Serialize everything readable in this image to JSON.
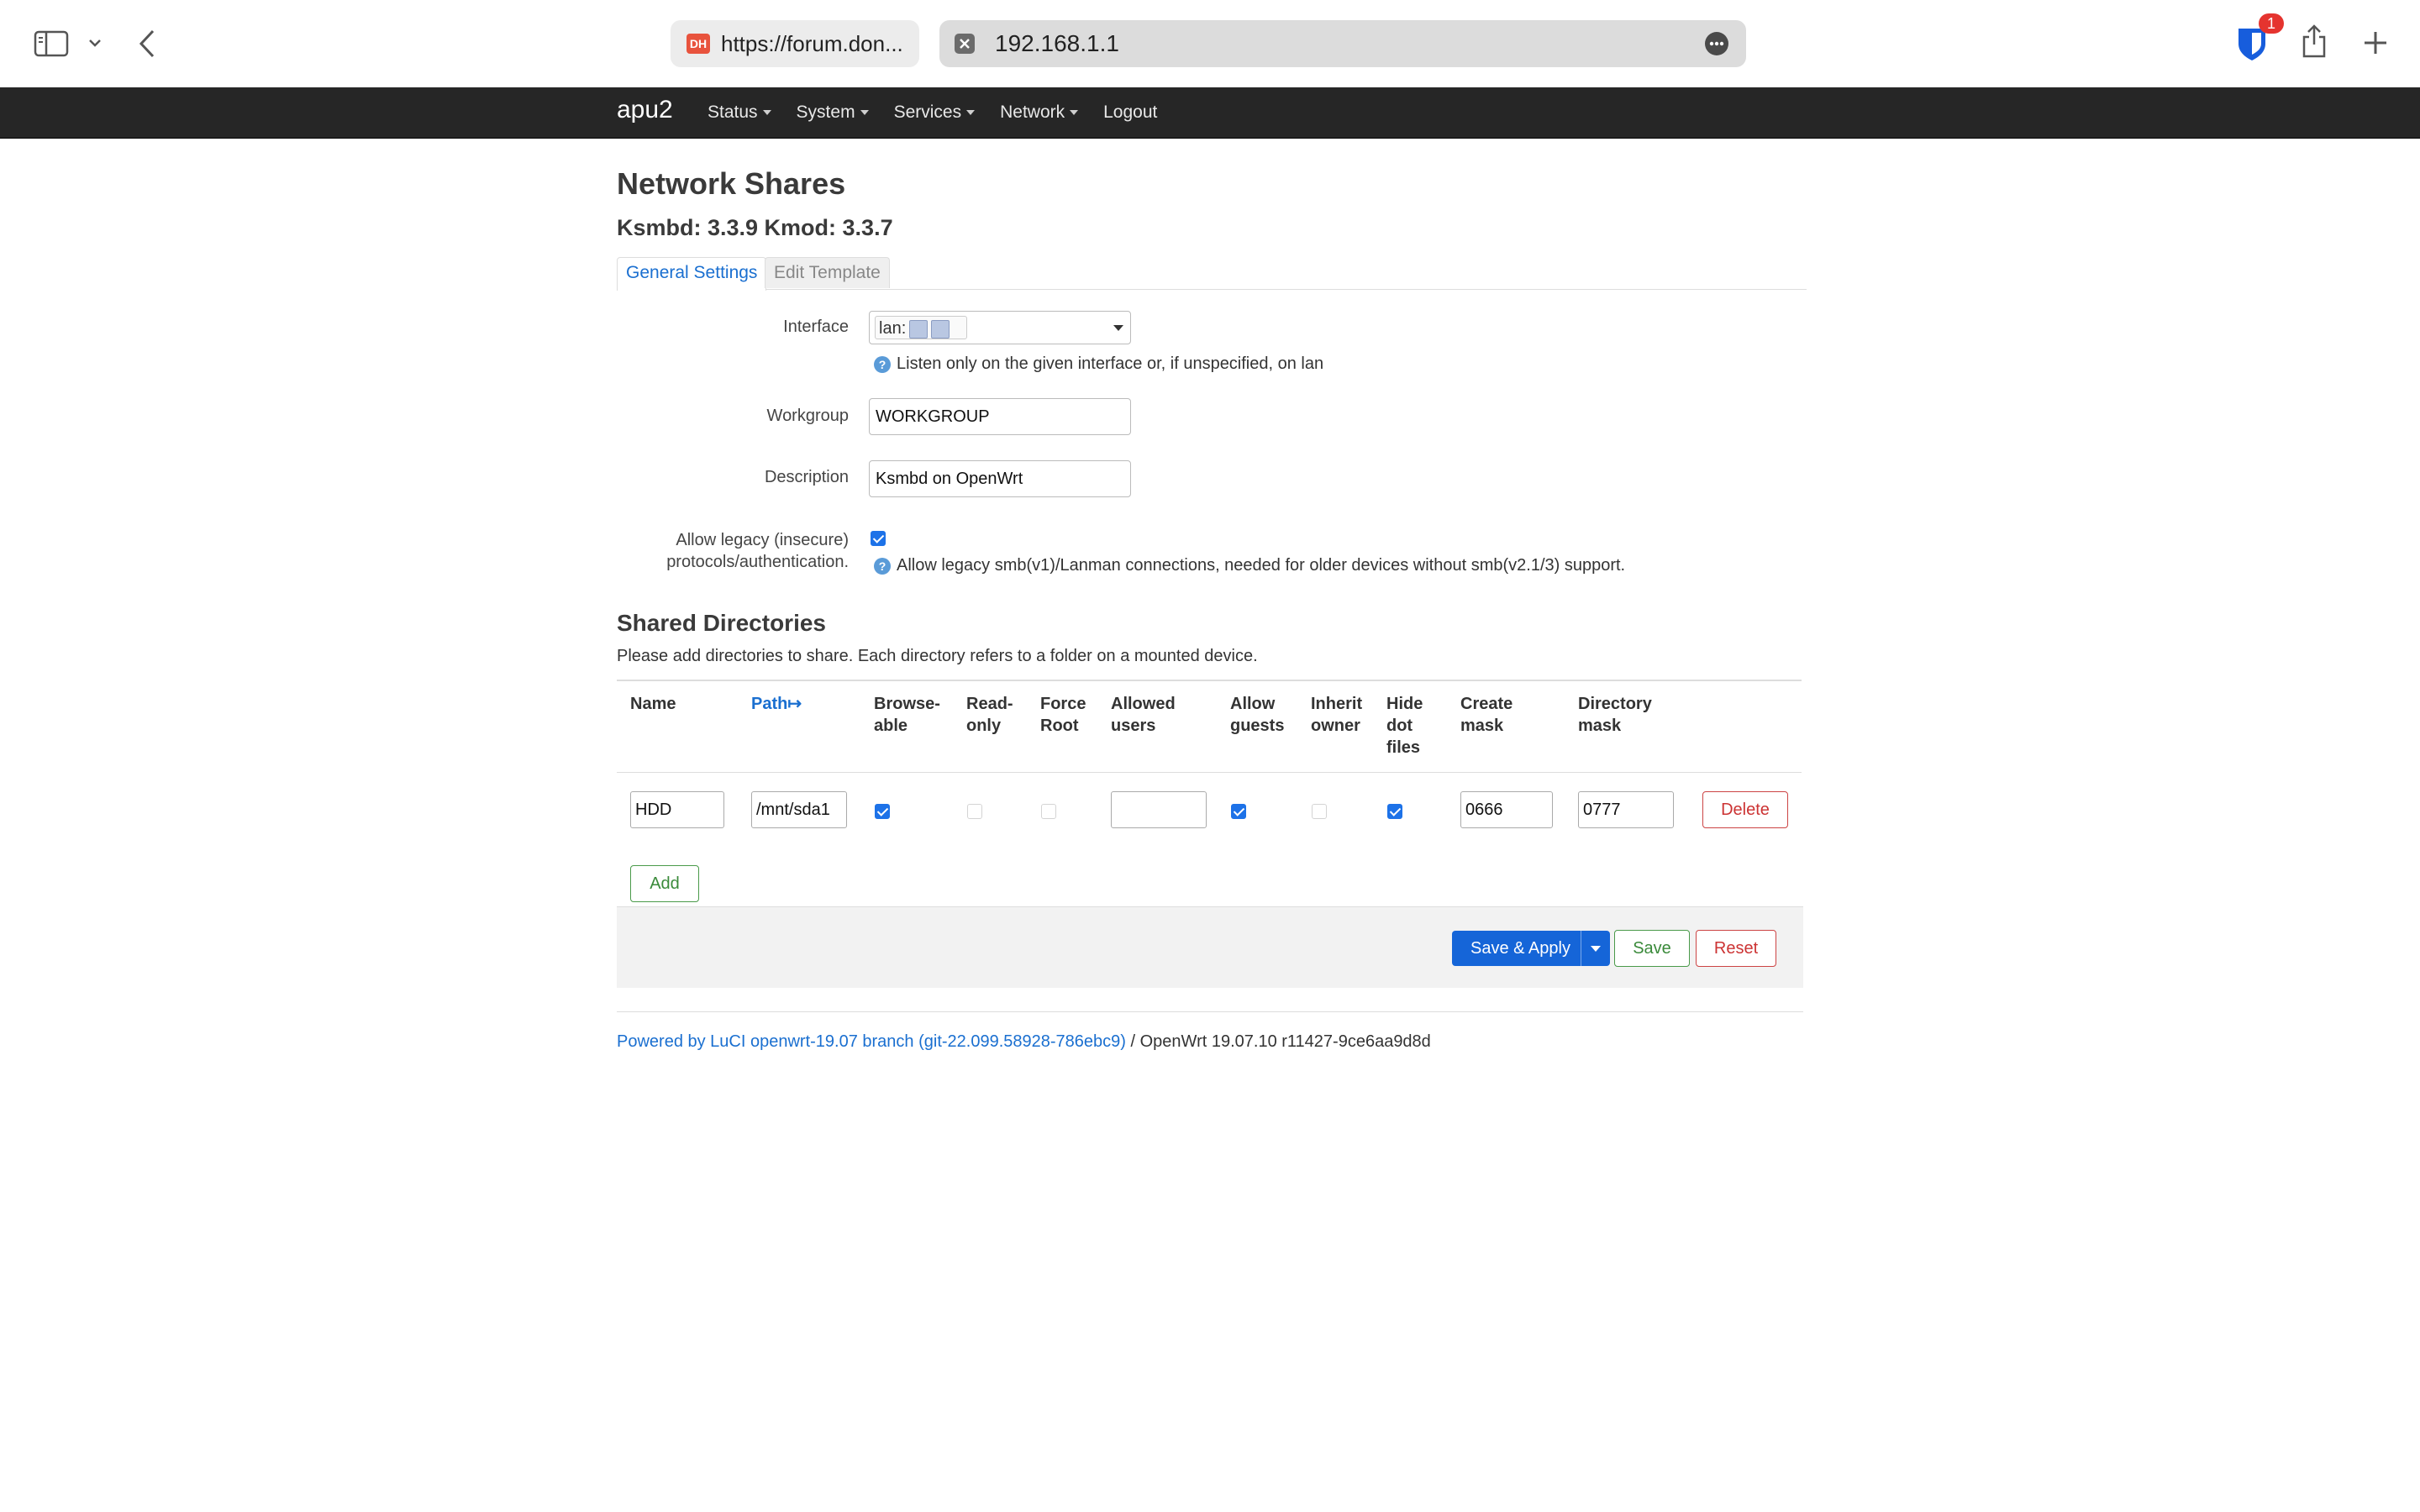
{
  "browser": {
    "tab1_url": "https://forum.don...",
    "tab2_url": "192.168.1.1",
    "extension_badge": "1"
  },
  "nav": {
    "brand": "apu2",
    "items": [
      {
        "label": "Status",
        "has_caret": true
      },
      {
        "label": "System",
        "has_caret": true
      },
      {
        "label": "Services",
        "has_caret": true
      },
      {
        "label": "Network",
        "has_caret": true
      },
      {
        "label": "Logout",
        "has_caret": false
      }
    ]
  },
  "page": {
    "title": "Network Shares",
    "version": "Ksmbd: 3.3.9 Kmod: 3.3.7",
    "tabs": {
      "general": "General Settings",
      "template": "Edit Template"
    }
  },
  "form": {
    "interface": {
      "label": "Interface",
      "value": "lan:",
      "help": "Listen only on the given interface or, if unspecified, on lan"
    },
    "workgroup": {
      "label": "Workgroup",
      "value": "WORKGROUP"
    },
    "description": {
      "label": "Description",
      "value": "Ksmbd on OpenWrt"
    },
    "legacy": {
      "label_line1": "Allow legacy (insecure)",
      "label_line2": "protocols/authentication.",
      "checked": true,
      "help": "Allow legacy smb(v1)/Lanman connections, needed for older devices without smb(v2.1/3) support."
    }
  },
  "shares": {
    "title": "Shared Directories",
    "description": "Please add directories to share. Each directory refers to a folder on a mounted device.",
    "columns": {
      "name": "Name",
      "path": "Path",
      "path_sort": "↦",
      "browseable_1": "Browse-",
      "browseable_2": "able",
      "readonly_1": "Read-",
      "readonly_2": "only",
      "forceroot_1": "Force",
      "forceroot_2": "Root",
      "allowedusers_1": "Allowed",
      "allowedusers_2": "users",
      "allowguests_1": "Allow",
      "allowguests_2": "guests",
      "inherit_1": "Inherit",
      "inherit_2": "owner",
      "hidedot_1": "Hide",
      "hidedot_2": "dot",
      "hidedot_3": "files",
      "createmask_1": "Create",
      "createmask_2": "mask",
      "dirmask_1": "Directory",
      "dirmask_2": "mask"
    },
    "row": {
      "name": "HDD",
      "path": "/mnt/sda1",
      "browseable": true,
      "readonly": false,
      "force_root": false,
      "allowed_users": "",
      "allow_guests": true,
      "inherit_owner": false,
      "hide_dot_files": true,
      "create_mask": "0666",
      "dir_mask": "0777"
    },
    "delete_label": "Delete",
    "add_label": "Add"
  },
  "actions": {
    "save_apply": "Save & Apply",
    "save": "Save",
    "reset": "Reset"
  },
  "footer": {
    "powered_link": "Powered by LuCI openwrt-19.07 branch (git-22.099.58928-786ebc9)",
    "rest": " / OpenWrt 19.07.10 r11427-9ce6aa9d8d"
  }
}
